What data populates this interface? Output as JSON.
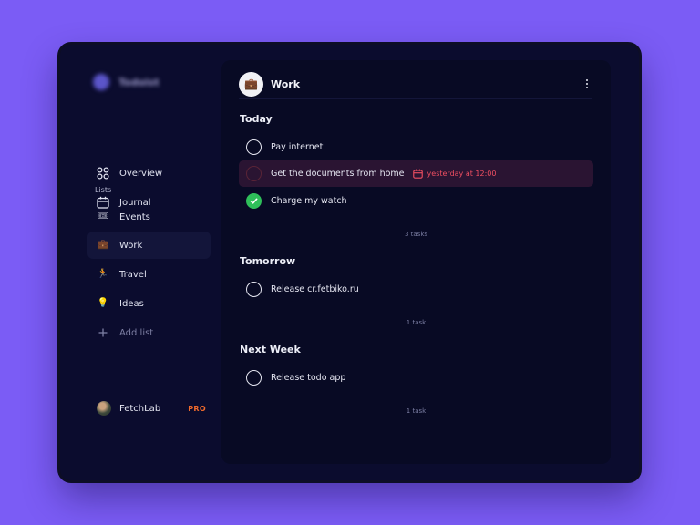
{
  "app": {
    "brand_name": "Todoist"
  },
  "sidebar": {
    "nav": [
      {
        "label": "Overview",
        "icon": "grid-icon"
      },
      {
        "label": "Journal",
        "icon": "calendar-icon"
      }
    ],
    "lists_label": "Lists",
    "lists": [
      {
        "label": "Events",
        "icon": "ticket-icon",
        "emoji": "🎟"
      },
      {
        "label": "Work",
        "icon": "briefcase-icon",
        "emoji": "💼",
        "active": true
      },
      {
        "label": "Travel",
        "icon": "runner-icon",
        "emoji": "🏃"
      },
      {
        "label": "Ideas",
        "icon": "lightbulb-icon",
        "emoji": "💡"
      }
    ],
    "add_list_label": "Add list",
    "user": {
      "name": "FetchLab",
      "badge": "PRO"
    }
  },
  "panel": {
    "title": "Work",
    "title_emoji": "💼",
    "groups": [
      {
        "title": "Today",
        "tasks": [
          {
            "text": "Pay internet",
            "done": false
          },
          {
            "text": "Get the documents from home",
            "done": false,
            "overdue": true,
            "due": "yesterday at 12:00"
          },
          {
            "text": "Charge my watch",
            "done": true
          }
        ],
        "count": "3 tasks"
      },
      {
        "title": "Tomorrow",
        "tasks": [
          {
            "text": "Release cr.fetbiko.ru",
            "done": false
          }
        ],
        "count": "1 task"
      },
      {
        "title": "Next Week",
        "tasks": [
          {
            "text": "Release todo app",
            "done": false
          }
        ],
        "count": "1 task"
      }
    ]
  },
  "colors": {
    "background": "#7b5cf5",
    "window": "#0b0c2e",
    "panel": "#080a24",
    "overdue": "#f04f62",
    "done": "#2fbf5a",
    "pro": "#f06a2c"
  }
}
